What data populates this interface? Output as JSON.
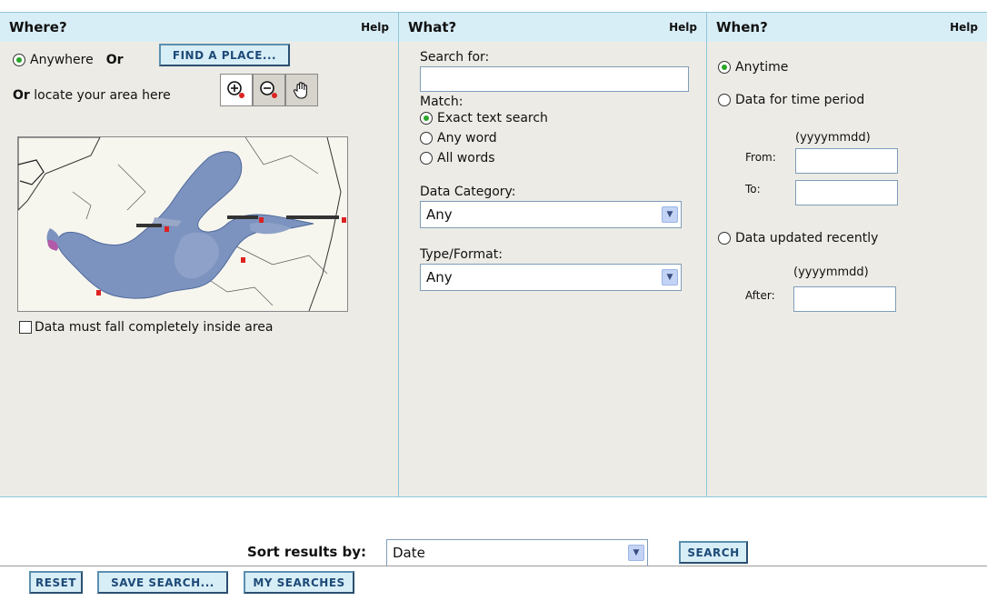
{
  "where": {
    "title": "Where?",
    "help": "Help",
    "anywhere_label": "Anywhere",
    "or_label": "Or",
    "find_place_button": "FIND A PLACE...",
    "locate_or": "Or",
    "locate_text": "locate your area here",
    "tools": [
      "zoom-in-icon",
      "zoom-out-icon",
      "pan-hand-icon"
    ],
    "inside_area_label": "Data must fall completely inside area"
  },
  "what": {
    "title": "What?",
    "help": "Help",
    "search_for_label": "Search for:",
    "search_value": "",
    "match_label": "Match:",
    "match_options": [
      "Exact text search",
      "Any word",
      "All words"
    ],
    "data_category_label": "Data Category:",
    "data_category_value": "Any",
    "type_format_label": "Type/Format:",
    "type_format_value": "Any"
  },
  "when": {
    "title": "When?",
    "help": "Help",
    "anytime_label": "Anytime",
    "period_label": "Data for time period",
    "date_format": "(yyyymmdd)",
    "from_label": "From:",
    "to_label": "To:",
    "updated_label": "Data updated recently",
    "updated_date_format": "(yyyymmdd)",
    "after_label": "After:"
  },
  "sort": {
    "label": "Sort results by:",
    "value": "Date",
    "search_button": "SEARCH"
  },
  "footer": {
    "reset_button": "RESET",
    "save_search_button": "SAVE SEARCH...",
    "my_searches_button": "MY SEARCHES"
  },
  "colors": {
    "panel_header": "#d8eef6",
    "panel_bg": "#ecebe5",
    "panel_border": "#8fc7d8",
    "button_text": "#1d4a78",
    "radio_selected": "#2aa52a"
  }
}
